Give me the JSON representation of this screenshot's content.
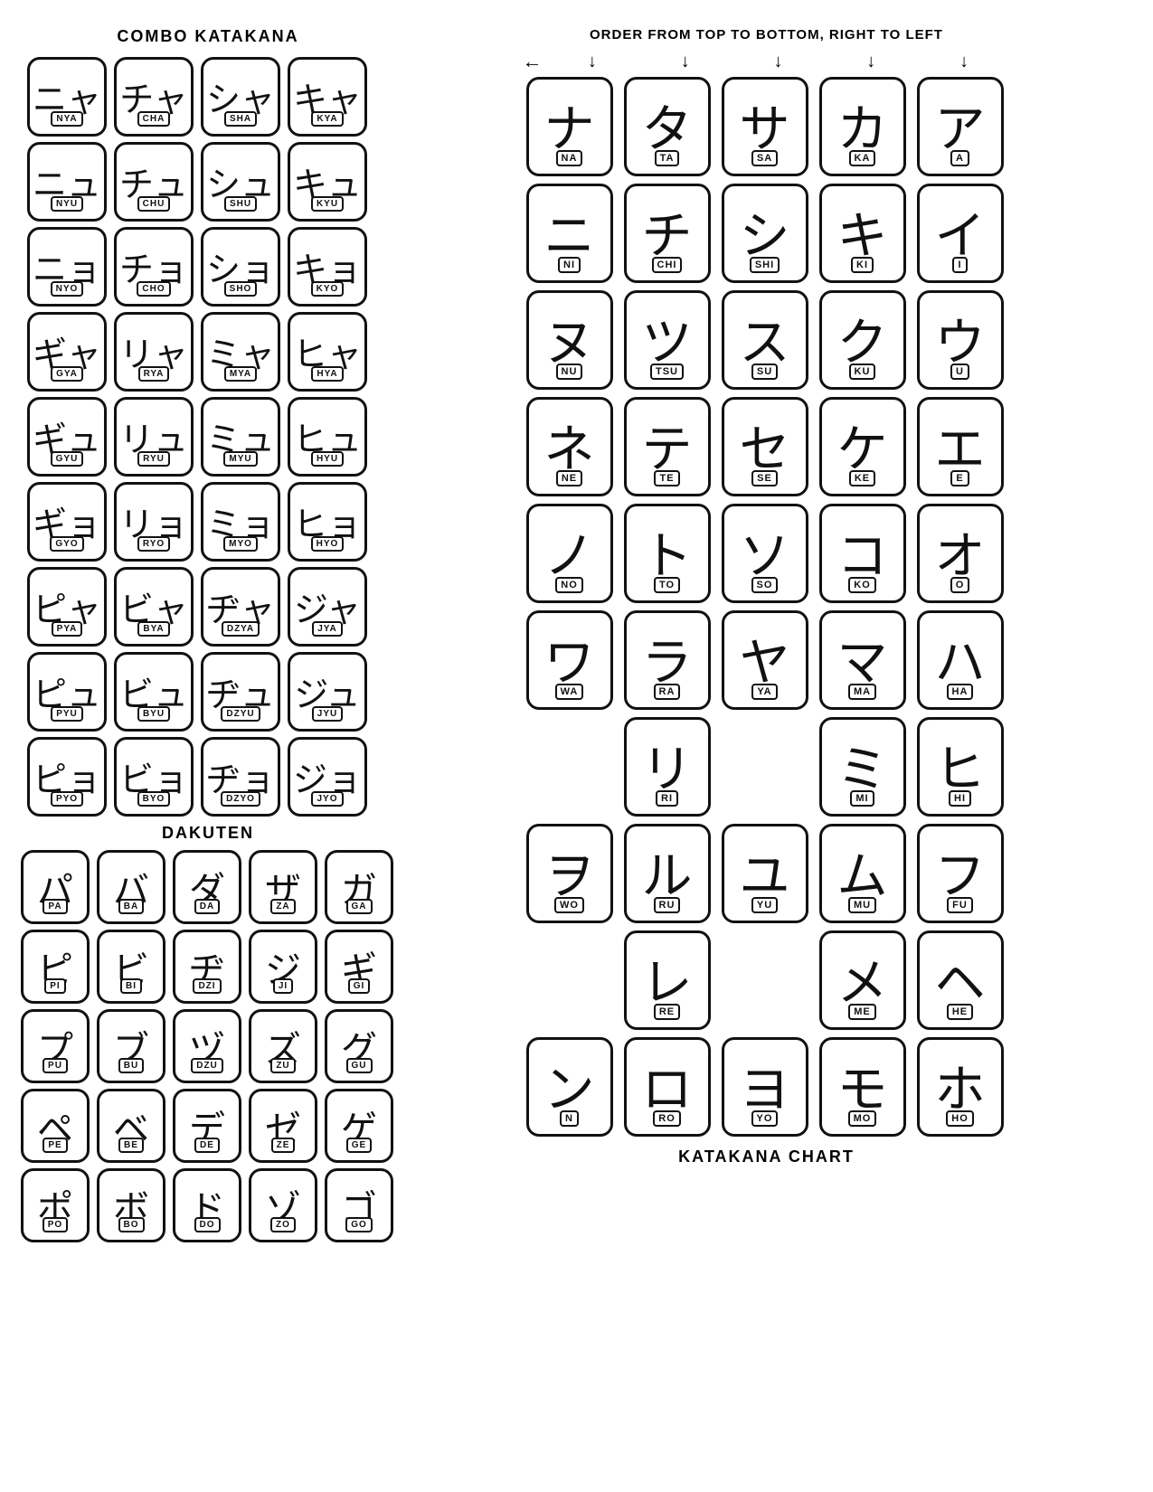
{
  "left": {
    "combo_title": "COMBO KATAKANA",
    "dakuten_title": "DAKUTEN",
    "combo_rows": [
      [
        {
          "char": "ニャ",
          "label": "NYA"
        },
        {
          "char": "チャ",
          "label": "CHA"
        },
        {
          "char": "シャ",
          "label": "SHA"
        },
        {
          "char": "キャ",
          "label": "KYA"
        }
      ],
      [
        {
          "char": "ニュ",
          "label": "NYU"
        },
        {
          "char": "チュ",
          "label": "CHU"
        },
        {
          "char": "シュ",
          "label": "SHU"
        },
        {
          "char": "キュ",
          "label": "KYU"
        }
      ],
      [
        {
          "char": "ニョ",
          "label": "NYO"
        },
        {
          "char": "チョ",
          "label": "CHO"
        },
        {
          "char": "ショ",
          "label": "SHO"
        },
        {
          "char": "キョ",
          "label": "KYO"
        }
      ],
      [
        {
          "char": "ギャ",
          "label": "GYA"
        },
        {
          "char": "リャ",
          "label": "RYA"
        },
        {
          "char": "ミャ",
          "label": "MYA"
        },
        {
          "char": "ヒャ",
          "label": "HYA"
        }
      ],
      [
        {
          "char": "ギュ",
          "label": "GYU"
        },
        {
          "char": "リュ",
          "label": "RYU"
        },
        {
          "char": "ミュ",
          "label": "MYU"
        },
        {
          "char": "ヒュ",
          "label": "HYU"
        }
      ],
      [
        {
          "char": "ギョ",
          "label": "GYO"
        },
        {
          "char": "リョ",
          "label": "RYO"
        },
        {
          "char": "ミョ",
          "label": "MYO"
        },
        {
          "char": "ヒョ",
          "label": "HYO"
        }
      ],
      [
        {
          "char": "ピャ",
          "label": "PYA"
        },
        {
          "char": "ビャ",
          "label": "BYA"
        },
        {
          "char": "ヂャ",
          "label": "DZYA"
        },
        {
          "char": "ジャ",
          "label": "JYA"
        }
      ],
      [
        {
          "char": "ピュ",
          "label": "PYU"
        },
        {
          "char": "ビュ",
          "label": "BYU"
        },
        {
          "char": "ヂュ",
          "label": "DZYU"
        },
        {
          "char": "ジュ",
          "label": "JYU"
        }
      ],
      [
        {
          "char": "ピョ",
          "label": "PYO"
        },
        {
          "char": "ビョ",
          "label": "BYO"
        },
        {
          "char": "ヂョ",
          "label": "DZYO"
        },
        {
          "char": "ジョ",
          "label": "JYO"
        }
      ]
    ],
    "dakuten_rows": [
      [
        {
          "char": "パ",
          "label": "PA"
        },
        {
          "char": "バ",
          "label": "BA"
        },
        {
          "char": "ダ",
          "label": "DA"
        },
        {
          "char": "ザ",
          "label": "ZA"
        },
        {
          "char": "ガ",
          "label": "GA"
        }
      ],
      [
        {
          "char": "ピ",
          "label": "PI"
        },
        {
          "char": "ビ",
          "label": "BI"
        },
        {
          "char": "ヂ",
          "label": "DZI"
        },
        {
          "char": "ジ",
          "label": "JI"
        },
        {
          "char": "ギ",
          "label": "GI"
        }
      ],
      [
        {
          "char": "プ",
          "label": "PU"
        },
        {
          "char": "ブ",
          "label": "BU"
        },
        {
          "char": "ヅ",
          "label": "DZU"
        },
        {
          "char": "ズ",
          "label": "ZU"
        },
        {
          "char": "グ",
          "label": "GU"
        }
      ],
      [
        {
          "char": "ペ",
          "label": "PE"
        },
        {
          "char": "ベ",
          "label": "BE"
        },
        {
          "char": "デ",
          "label": "DE"
        },
        {
          "char": "ゼ",
          "label": "ZE"
        },
        {
          "char": "ゲ",
          "label": "GE"
        }
      ],
      [
        {
          "char": "ポ",
          "label": "PO"
        },
        {
          "char": "ボ",
          "label": "BO"
        },
        {
          "char": "ド",
          "label": "DO"
        },
        {
          "char": "ゾ",
          "label": "ZO"
        },
        {
          "char": "ゴ",
          "label": "GO"
        }
      ]
    ]
  },
  "right": {
    "order_title": "ORDER FROM TOP TO BOTTOM, RIGHT TO LEFT",
    "chart_title": "KATAKANA CHART",
    "rows": [
      [
        {
          "char": "ナ",
          "label": "NA"
        },
        {
          "char": "タ",
          "label": "TA"
        },
        {
          "char": "サ",
          "label": "SA"
        },
        {
          "char": "カ",
          "label": "KA"
        },
        {
          "char": "ア",
          "label": "A"
        }
      ],
      [
        {
          "char": "ニ",
          "label": "NI"
        },
        {
          "char": "チ",
          "label": "CHI"
        },
        {
          "char": "シ",
          "label": "SHI"
        },
        {
          "char": "キ",
          "label": "KI"
        },
        {
          "char": "イ",
          "label": "I"
        }
      ],
      [
        {
          "char": "ヌ",
          "label": "NU"
        },
        {
          "char": "ツ",
          "label": "TSU"
        },
        {
          "char": "ス",
          "label": "SU"
        },
        {
          "char": "ク",
          "label": "KU"
        },
        {
          "char": "ウ",
          "label": "U"
        }
      ],
      [
        {
          "char": "ネ",
          "label": "NE"
        },
        {
          "char": "テ",
          "label": "TE"
        },
        {
          "char": "セ",
          "label": "SE"
        },
        {
          "char": "ケ",
          "label": "KE"
        },
        {
          "char": "エ",
          "label": "E"
        }
      ],
      [
        {
          "char": "ノ",
          "label": "NO"
        },
        {
          "char": "ト",
          "label": "TO"
        },
        {
          "char": "ソ",
          "label": "SO"
        },
        {
          "char": "コ",
          "label": "KO"
        },
        {
          "char": "オ",
          "label": "O"
        }
      ],
      [
        {
          "char": "ワ",
          "label": "WA"
        },
        {
          "char": "ラ",
          "label": "RA"
        },
        {
          "char": "ヤ",
          "label": "YA"
        },
        {
          "char": "マ",
          "label": "MA"
        },
        {
          "char": "ハ",
          "label": "HA"
        }
      ],
      [
        {
          "char": "",
          "label": ""
        },
        {
          "char": "リ",
          "label": "RI"
        },
        {
          "char": "",
          "label": ""
        },
        {
          "char": "ミ",
          "label": "MI"
        },
        {
          "char": "ヒ",
          "label": "HI"
        }
      ],
      [
        {
          "char": "ヲ",
          "label": "WO"
        },
        {
          "char": "ル",
          "label": "RU"
        },
        {
          "char": "ユ",
          "label": "YU"
        },
        {
          "char": "ム",
          "label": "MU"
        },
        {
          "char": "フ",
          "label": "FU"
        }
      ],
      [
        {
          "char": "",
          "label": ""
        },
        {
          "char": "レ",
          "label": "RE"
        },
        {
          "char": "",
          "label": ""
        },
        {
          "char": "メ",
          "label": "ME"
        },
        {
          "char": "ヘ",
          "label": "HE"
        }
      ],
      [
        {
          "char": "ン",
          "label": "N"
        },
        {
          "char": "ロ",
          "label": "RO"
        },
        {
          "char": "ヨ",
          "label": "YO"
        },
        {
          "char": "モ",
          "label": "MO"
        },
        {
          "char": "ホ",
          "label": "HO"
        }
      ]
    ]
  }
}
